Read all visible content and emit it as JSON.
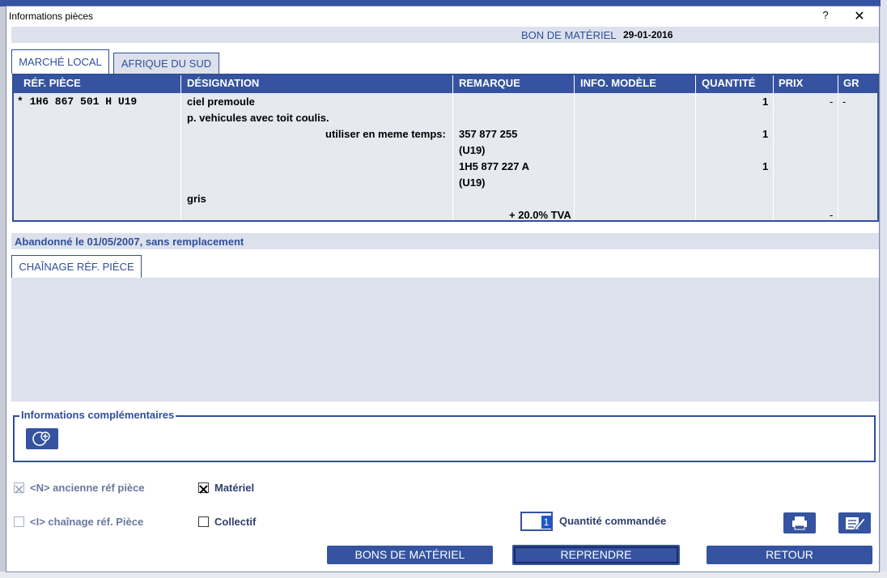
{
  "window": {
    "title": "Informations pièces",
    "help": "?",
    "close": "✕"
  },
  "header": {
    "bon_label": "BON DE MATÉRIEL",
    "bon_date": "29-01-2016"
  },
  "tabs": [
    {
      "label": "MARCHÉ LOCAL",
      "active": true
    },
    {
      "label": "AFRIQUE DU SUD",
      "active": false
    }
  ],
  "table": {
    "columns": [
      "RÉF. PIÈCE",
      "DÉSIGNATION",
      "REMARQUE",
      "INFO. MODÈLE",
      "QUANTITÉ",
      "PRIX",
      "GR"
    ],
    "ref": "* 1H6 867 501 H  U19",
    "designation_lines": [
      "ciel premoule",
      "p. vehicules avec toit coulis.",
      "utiliser en meme temps:",
      "gris"
    ],
    "remarque_lines": [
      "357 877 255",
      "(U19)",
      "1H5 877 227 A",
      "(U19)"
    ],
    "tva": "+ 20.0% TVA",
    "quantites": [
      "1",
      "1",
      "1"
    ],
    "prix": [
      "-",
      "-"
    ],
    "gr": "-"
  },
  "status": {
    "abandon": "Abandonné le 01/05/2007, sans remplacement"
  },
  "chain_tab": {
    "label": "CHAÎNAGE RÉF. PIÈCE"
  },
  "info": {
    "label": "Informations complémentaires"
  },
  "options": {
    "ancienne": {
      "label": "<N> ancienne réf pièce",
      "checked": true,
      "enabled": false
    },
    "chainage": {
      "label": "<I> chaînage réf. Pièce",
      "checked": false,
      "enabled": false
    },
    "materiel": {
      "label": "Matériel",
      "checked": true
    },
    "collectif": {
      "label": "Collectif",
      "checked": false
    }
  },
  "quantity": {
    "value": "1",
    "label": "Quantité commandée"
  },
  "buttons": {
    "bons": "BONS DE MATÉRIEL",
    "reprendre": "REPRENDRE",
    "retour": "RETOUR"
  },
  "icons": {
    "info_add": "add-circle-icon",
    "print": "printer-icon",
    "edit": "edit-note-icon"
  },
  "colors": {
    "accent": "#3553a0",
    "panel": "#dde1ec",
    "text_accent": "#2f4f9c"
  }
}
